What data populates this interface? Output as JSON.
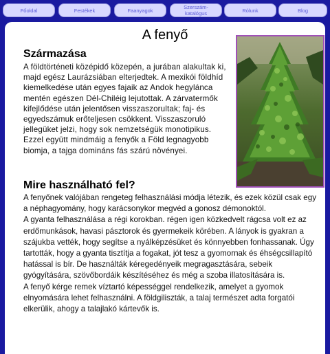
{
  "nav": {
    "items": [
      {
        "label": "Főoldal"
      },
      {
        "label": "Festékek"
      },
      {
        "label": "Faanyagok"
      },
      {
        "label": "Szerszám-\nkatalógus"
      },
      {
        "label": "Rólunk"
      },
      {
        "label": "Blog"
      }
    ]
  },
  "page": {
    "title": "A fenyő",
    "origin_heading": "Származása",
    "origin_text": "A földtörténeti középidő közepén, a jurában alakultak ki, majd egész Laurázsiában elterjedtek. A mexikói földhíd kiemelkedése után egyes fajaik az Andok hegyláncа mentén egészen Dél-Chiléig lejutottak. A zárvatermők kifejlődése után jelentősen visszaszorultak; faj- és egyedszámuk erőteljesen csökkent. Visszaszoruló jellegüket jelzi, hogy sok nemzetségük monotipikus. Ezzel együtt mindmáig a fenyők a Föld legnagyobb biomja, a tajga domináns fás szárú növényei.",
    "use_heading": "Mire használható fel?",
    "use_paragraphs": [
      "A fenyőnek valójában rengeteg felhasználási módja létezik, és ezek közül csak egy a néphagyomány, hogy karácsonykor megvéd a gonosz démonoktól.",
      "A gyanta felhasználása a régi korokban. régen igen közkedvelt rágcsa volt ez az erdőmunkások, havasi pásztorok és gyermekeik körében. A lányok is gyakran a szájukba vették, hogy segítse a nyálképzésüket és könnyebben fonhassanak. Úgy tartották, hogy a gyanta tisztítja a fogakat, jót tesz a gyomornak és éhségcsillapító hatással is bír. De használták kéregedényeik megragasztására, sebeik gyógyítására, szövőbordáik készítéséhez és még a szoba illatosítására is.",
      "A fenyő kérge remek víztartó képességgel rendelkezik, amelyet a gyomok elnyomására lehet felhasználni. A földgiliszták, a talaj természet adta forgatói elkerülik, ahogy a talajlakó  kártevők is."
    ]
  },
  "colors": {
    "background": "#1a1aa0",
    "nav_button": "#d8d8ff",
    "nav_text": "#5a5ad8",
    "photo_border": "#a050b8"
  }
}
